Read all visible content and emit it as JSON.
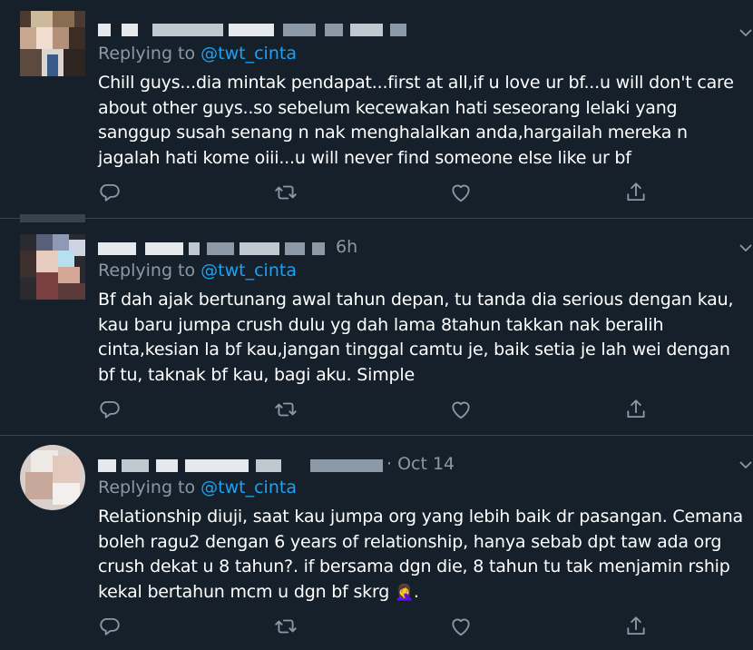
{
  "tweets": [
    {
      "time": "",
      "replying_prefix": "Replying to",
      "replying_handle": "@twt_cinta",
      "text": "Chill guys...dia mintak pendapat...first at all,if u love ur bf...u will don't care about other guys..so sebelum kecewakan hati seseorang lelaki yang sanggup susah senang n nak menghalalkan anda,hargailah mereka n jagalah hati kome oiii...u will never find someone else like ur bf"
    },
    {
      "time": "6h",
      "replying_prefix": "Replying to",
      "replying_handle": "@twt_cinta",
      "text": "Bf dah ajak bertunang awal tahun depan, tu tanda dia serious dengan kau, kau baru jumpa crush dulu yg dah lama 8tahun takkan nak beralih cinta,kesian la bf kau,jangan tinggal camtu je, baik setia je lah wei dengan bf tu, taknak bf kau, bagi aku. Simple"
    },
    {
      "time": "· Oct 14",
      "replying_prefix": "Replying to",
      "replying_handle": "@twt_cinta",
      "text": "Relationship diuji, saat kau jumpa org yang lebih baik dr pasangan. Cemana boleh ragu2 dengan 6 years of relationship, hanya sebab dpt taw ada org crush dekat u 8 tahun?. if bersama dgn die, 8 tahun tu tak menjamin rship kekal bertahun mcm u dgn bf skrg",
      "emoji": "🤦‍♀️",
      "suffix": "."
    }
  ],
  "colors": {
    "background": "#15202b",
    "secondary_text": "#8b98a5",
    "accent": "#1da1f2",
    "divider": "#38444d"
  },
  "icons": [
    "reply-icon",
    "retweet-icon",
    "like-icon",
    "share-icon",
    "chevron-down-icon"
  ]
}
